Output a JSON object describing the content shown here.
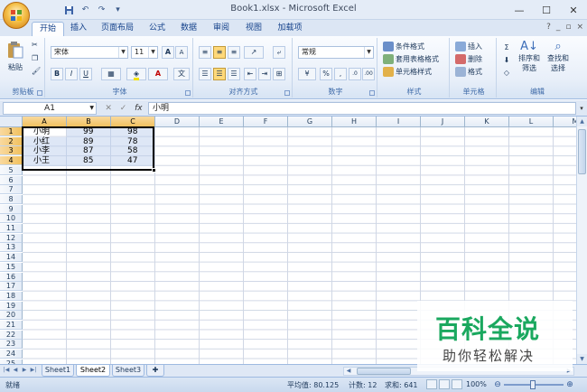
{
  "window": {
    "title": "Book1.xlsx - Microsoft Excel",
    "controls": [
      "—",
      "☐",
      "✕"
    ]
  },
  "qat": [
    "save-icon",
    "undo-icon",
    "redo-icon",
    "customize-icon"
  ],
  "tabs": [
    "开始",
    "插入",
    "页面布局",
    "公式",
    "数据",
    "审阅",
    "视图",
    "加载项"
  ],
  "ribbon": {
    "clipboard": {
      "paste": "粘贴",
      "label": "剪贴板"
    },
    "font": {
      "name": "宋体",
      "size": "11",
      "label": "字体",
      "bold": "B",
      "italic": "I",
      "underline": "U",
      "grow": "A",
      "shrink": "A"
    },
    "alignment": {
      "label": "对齐方式"
    },
    "number": {
      "format": "常规",
      "percent": "%",
      "comma": ",",
      "label": "数字"
    },
    "styles": {
      "conditional": "条件格式",
      "table": "套用表格格式",
      "cell": "单元格样式",
      "label": "样式"
    },
    "cells": {
      "insert": "插入",
      "delete": "删除",
      "format": "格式",
      "label": "单元格"
    },
    "editing": {
      "sort": "排序和",
      "sort2": "筛选",
      "find": "查找和",
      "find2": "选择",
      "label": "编辑"
    }
  },
  "formula": {
    "namebox": "A1",
    "fx": "fx",
    "content": "小明"
  },
  "columns": [
    "A",
    "B",
    "C",
    "D",
    "E",
    "F",
    "G",
    "H",
    "I",
    "J",
    "K",
    "L",
    "M"
  ],
  "rows": [
    "1",
    "2",
    "3",
    "4",
    "5",
    "6",
    "7",
    "8",
    "9",
    "10",
    "11",
    "12",
    "13",
    "14",
    "15",
    "16",
    "17",
    "18",
    "19",
    "20",
    "21",
    "22",
    "23",
    "24",
    "25"
  ],
  "cells": [
    [
      "小明",
      "99",
      "98"
    ],
    [
      "小红",
      "89",
      "78"
    ],
    [
      "小李",
      "87",
      "58"
    ],
    [
      "小王",
      "85",
      "47"
    ]
  ],
  "sheets": [
    "Sheet1",
    "Sheet2",
    "Sheet3"
  ],
  "status": {
    "ready": "就绪",
    "average": "平均值: 80.125",
    "count": "计数: 12",
    "sum": "求和: 641",
    "zoom": "100%"
  },
  "watermark": {
    "title": "百科全说",
    "sub": "助你轻松解决"
  }
}
